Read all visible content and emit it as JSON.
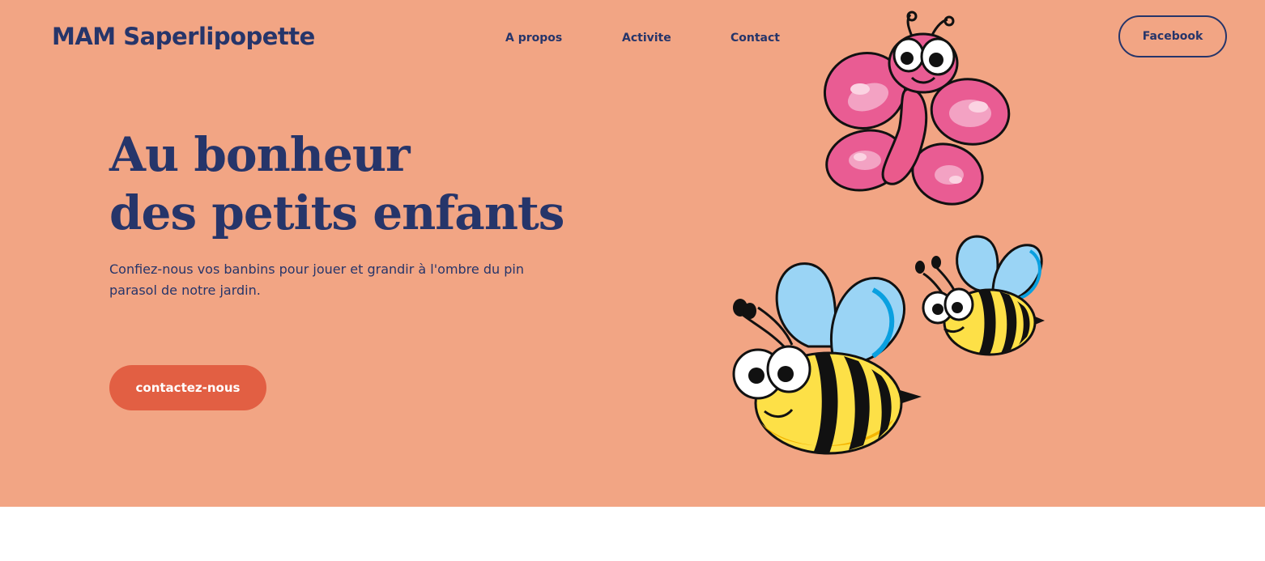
{
  "header": {
    "brand": "MAM Saperlipopette",
    "nav": [
      {
        "label": "A propos"
      },
      {
        "label": "Activite"
      },
      {
        "label": "Contact"
      }
    ],
    "facebook_label": "Facebook"
  },
  "hero": {
    "headline_line1": "Au bonheur",
    "headline_line2": "des petits enfants",
    "subtitle": "Confiez-nous vos banbins pour jouer et grandir à l'ombre du pin parasol de notre jardin.",
    "cta_label": "contactez-nous"
  },
  "illustrations": {
    "butterfly": "butterfly-illustration",
    "bees": [
      "bee-large-illustration",
      "bee-small-illustration"
    ]
  },
  "colors": {
    "hero_background": "#f2a584",
    "text_primary": "#26356a",
    "cta_background": "#e25f43",
    "page_background": "#ffffff"
  }
}
